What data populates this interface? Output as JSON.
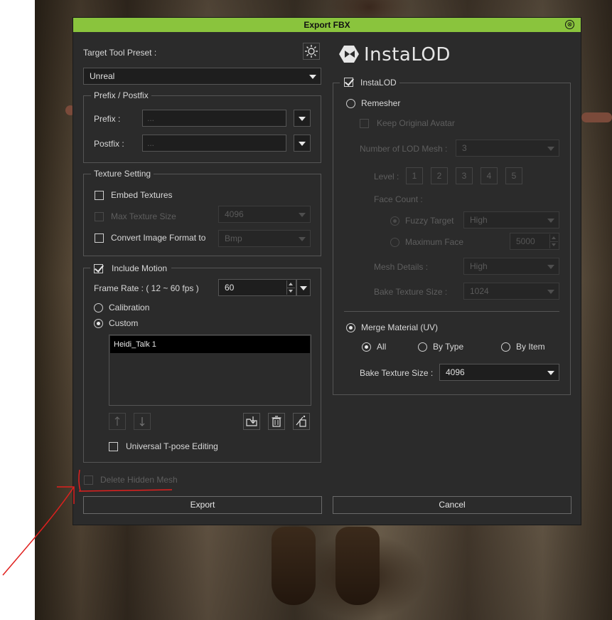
{
  "dialog": {
    "title": "Export FBX",
    "close_glyph": "⊗"
  },
  "colors": {
    "title_bar": "#8ac43d",
    "dialog_bg": "#2b2b2b",
    "annotation": "#e0201e"
  },
  "left": {
    "preset_label": "Target Tool Preset :",
    "preset_icon": "gear-icon",
    "preset_value": "Unreal",
    "prefix_group": {
      "title": "Prefix / Postfix",
      "prefix_label": "Prefix :",
      "prefix_placeholder": "...",
      "postfix_label": "Postfix :",
      "postfix_placeholder": "..."
    },
    "texture_group": {
      "title": "Texture Setting",
      "embed_label": "Embed Textures",
      "embed_checked": false,
      "max_size_label": "Max Texture Size",
      "max_size_value": "4096",
      "convert_label": "Convert Image Format to",
      "convert_checked": false,
      "convert_value": "Bmp"
    },
    "motion_group": {
      "title": "Include Motion",
      "include_checked": true,
      "frame_rate_label": "Frame Rate : ( 12 ~ 60 fps )",
      "frame_rate_value": "60",
      "calibration_label": "Calibration",
      "custom_label": "Custom",
      "selected": "Custom",
      "motions": [
        "Heidi_Talk 1"
      ],
      "tpose_label": "Universal T-pose Editing",
      "tpose_checked": false,
      "icons": [
        "arrow-up-icon",
        "arrow-down-icon",
        "import-folder-icon",
        "trash-icon",
        "auto-motion-icon"
      ]
    },
    "delete_hidden_label": "Delete Hidden Mesh",
    "delete_hidden_checked": false
  },
  "right": {
    "logo_text": "InstaLOD",
    "instalod_label": "InstaLOD",
    "instalod_checked": true,
    "remesher_label": "Remesher",
    "keep_avatar_label": "Keep Original Avatar",
    "lod_mesh_label": "Number of LOD Mesh :",
    "lod_mesh_value": "3",
    "level_label": "Level :",
    "levels": [
      "1",
      "2",
      "3",
      "4",
      "5"
    ],
    "face_count_label": "Face Count :",
    "fuzzy_label": "Fuzzy Target",
    "fuzzy_value": "High",
    "max_face_label": "Maximum Face",
    "max_face_value": "5000",
    "mesh_details_label": "Mesh Details :",
    "mesh_details_value": "High",
    "bake_size_label_1": "Bake Texture Size :",
    "bake_size_value_1": "1024",
    "merge_label": "Merge Material (UV)",
    "merge_selected": true,
    "all_label": "All",
    "by_type_label": "By Type",
    "by_item_label": "By Item",
    "merge_option": "All",
    "bake_size_label_2": "Bake Texture Size :",
    "bake_size_value_2": "4096"
  },
  "buttons": {
    "export": "Export",
    "cancel": "Cancel"
  }
}
